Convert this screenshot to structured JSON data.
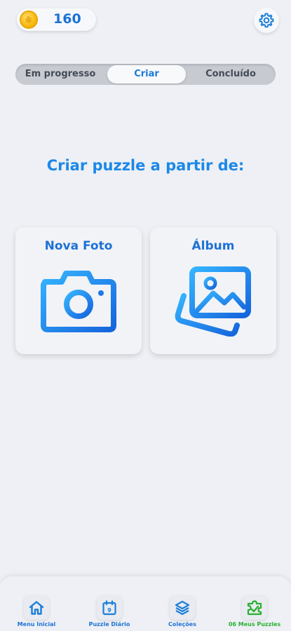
{
  "header": {
    "coins": "160",
    "coin_icon": "coin-icon",
    "settings_icon": "gear-icon"
  },
  "tabs": [
    {
      "label": "Em progresso",
      "active": false
    },
    {
      "label": "Criar",
      "active": true
    },
    {
      "label": "Concluído",
      "active": false
    }
  ],
  "main": {
    "heading": "Criar puzzle a partir de:",
    "options": [
      {
        "label": "Nova Foto",
        "icon": "camera-icon"
      },
      {
        "label": "Álbum",
        "icon": "photo-album-icon"
      }
    ]
  },
  "bottom_nav": [
    {
      "label": "Menu Inicial",
      "icon": "home-icon",
      "active": false
    },
    {
      "label": "Puzzle Diário",
      "icon": "calendar-icon",
      "badge": "9",
      "active": false
    },
    {
      "label": "Coleções",
      "icon": "layers-icon",
      "active": false
    },
    {
      "label": "06 Meus Puzzles",
      "icon": "puzzle-icon",
      "active": true
    }
  ],
  "colors": {
    "accent_blue": "#1c88e8",
    "active_green": "#29b12f",
    "background": "#eef0f5",
    "coin_gold": "#f5b400"
  }
}
